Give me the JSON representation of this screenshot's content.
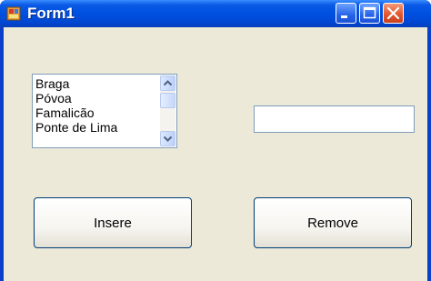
{
  "window": {
    "title": "Form1"
  },
  "titlebar_buttons": {
    "minimize": "minimize-icon",
    "maximize": "maximize-icon",
    "close": "close-icon"
  },
  "listbox": {
    "items": [
      "Braga",
      "Póvoa",
      "Famalicão",
      "Ponte de Lima"
    ]
  },
  "textbox": {
    "value": ""
  },
  "buttons": {
    "insert_label": "Insere",
    "remove_label": "Remove"
  },
  "colors": {
    "titlebar": "#0050e0",
    "client_background": "#ece9d8",
    "close_button": "#e4572e"
  }
}
